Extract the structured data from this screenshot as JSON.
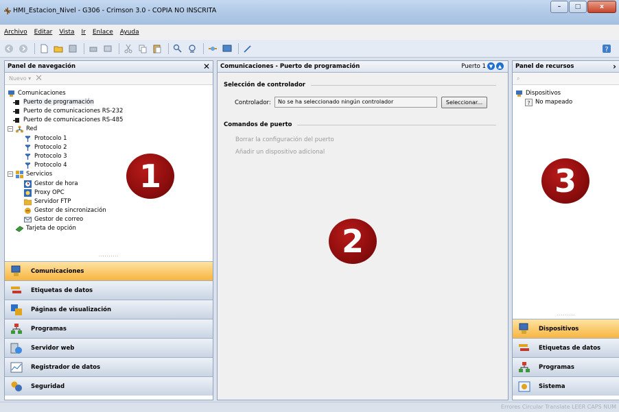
{
  "window": {
    "title": "HMI_Estacion_Nivel - G306 - Crimson 3.0 - COPIA NO INSCRITA",
    "controls": {
      "minimize": "–",
      "maximize": "□",
      "close": "x"
    }
  },
  "menu": [
    "Archivo",
    "Editar",
    "Vista",
    "Ir",
    "Enlace",
    "Ayuda"
  ],
  "toolbar": {
    "icons": [
      "back-icon",
      "forward-icon",
      "new-file-icon",
      "open-folder-icon",
      "save-icon",
      "print-icon",
      "print-preview-icon",
      "cut-icon",
      "copy-icon",
      "paste-icon",
      "find-icon",
      "replace-icon",
      "link-icon",
      "monitor-icon",
      "wand-icon",
      "help-icon"
    ]
  },
  "nav_panel": {
    "title": "Panel de navegación",
    "new_label": "Nuevo ▾",
    "tree": {
      "comunicaciones": "Comunicaciones",
      "puerto_prog": "Puerto de programación",
      "rs232": "Puerto de comunicaciones RS-232",
      "rs485": "Puerto de comunicaciones RS-485",
      "red": "Red",
      "protocolos": [
        "Protocolo 1",
        "Protocolo 2",
        "Protocolo 3",
        "Protocolo 4"
      ],
      "servicios": "Servicios",
      "servicios_items": [
        "Gestor de hora",
        "Proxy OPC",
        "Servidor FTP",
        "Gestor de sincronización",
        "Gestor de correo"
      ],
      "tarjeta": "Tarjeta de opción"
    },
    "sections": [
      "Comunicaciones",
      "Etiquetas de datos",
      "Páginas de visualización",
      "Programas",
      "Servidor web",
      "Registrador de datos",
      "Seguridad"
    ]
  },
  "center_panel": {
    "title": "Comunicaciones - Puerto de programación",
    "port": "Puerto 1",
    "group1": "Selección de controlador",
    "controller_label": "Controlador:",
    "controller_value": "No se ha seleccionado ningún controlador",
    "select_button": "Seleccionar...",
    "group2": "Comandos de puerto",
    "commands": [
      "Borrar la configuración del puerto",
      "Añadir un dispositivo adicional"
    ]
  },
  "resource_panel": {
    "title": "Panel de recursos",
    "devices": "Dispositivos",
    "unmapped": "No mapeado",
    "sections": [
      "Dispositivos",
      "Etiquetas de datos",
      "Programas",
      "Sistema"
    ]
  },
  "status": "Errores  Circular  Translate  LEER  CAPS  NUM",
  "badges": [
    "1",
    "2",
    "3"
  ],
  "colors": {
    "active_section": "#f8b540",
    "badge": "#8c0d0d",
    "accent_blue": "#1f6fd0"
  }
}
